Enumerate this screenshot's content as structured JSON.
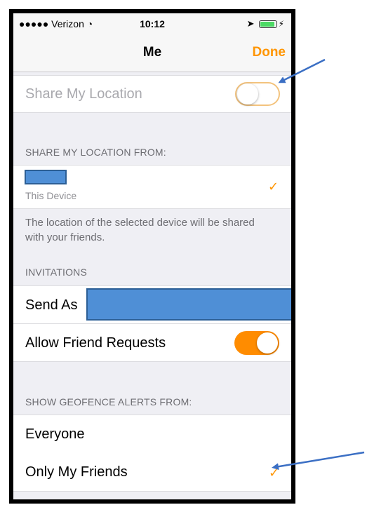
{
  "status_bar": {
    "carrier": "●●●●● Verizon",
    "time": "10:12"
  },
  "nav": {
    "title": "Me",
    "done_label": "Done"
  },
  "share_location": {
    "label": "Share My Location",
    "enabled": false
  },
  "share_from": {
    "header": "SHARE MY LOCATION FROM:",
    "device_subtitle": "This Device",
    "footer": "The location of the selected device will be shared with your friends."
  },
  "invitations": {
    "header": "INVITATIONS",
    "send_as_label": "Send As",
    "allow_requests_label": "Allow Friend Requests",
    "allow_requests_enabled": true
  },
  "geofence": {
    "header": "SHOW GEOFENCE ALERTS FROM:",
    "options": [
      "Everyone",
      "Only My Friends"
    ]
  },
  "colors": {
    "accent": "#ff9500",
    "annotation_arrow": "#3b6fc4",
    "redaction": "#4f8fd6"
  }
}
